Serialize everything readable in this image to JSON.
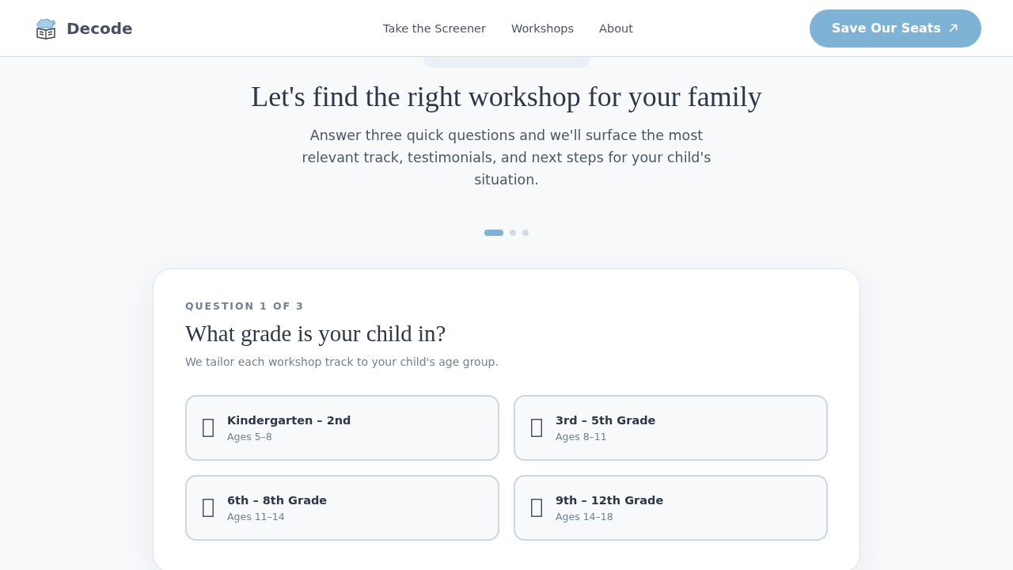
{
  "header": {
    "brand": "Decode",
    "nav": [
      {
        "label": "Take the Screener"
      },
      {
        "label": "Workshops"
      },
      {
        "label": "About"
      }
    ],
    "cta": "Save Our Seats"
  },
  "hero": {
    "title": "Let's find the right workshop for your family",
    "subtitle": "Answer three quick questions and we'll surface the most relevant track, testimonials, and next steps for your child's situation.",
    "steps": [
      {
        "selected": true
      },
      {
        "selected": false
      },
      {
        "selected": false
      }
    ]
  },
  "question": {
    "eyebrow": "QUESTION 1 OF 3",
    "title": "What grade is your child in?",
    "hint": "We tailor each workshop track to your child's age group.",
    "options": [
      {
        "label": "Kindergarten – 2nd",
        "ages": "Ages 5–8"
      },
      {
        "label": "3rd – 5th Grade",
        "ages": "Ages 8–11"
      },
      {
        "label": "6th – 8th Grade",
        "ages": "Ages 11–14"
      },
      {
        "label": "9th – 12th Grade",
        "ages": "Ages 14–18"
      }
    ]
  }
}
